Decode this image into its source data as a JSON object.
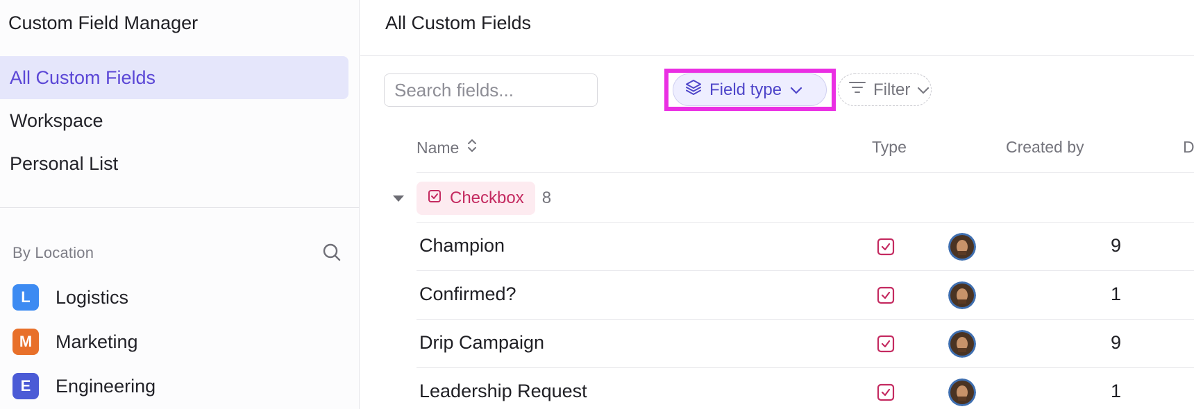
{
  "sidebar": {
    "title": "Custom Field Manager",
    "nav": [
      {
        "label": "All Custom Fields",
        "active": true
      },
      {
        "label": "Workspace",
        "active": false
      },
      {
        "label": "Personal List",
        "active": false
      }
    ],
    "section_label": "By Location",
    "section_search_icon": "search-icon",
    "locations": [
      {
        "badge": "L",
        "label": "Logistics",
        "color": "#3d8bf2"
      },
      {
        "badge": "M",
        "label": "Marketing",
        "color": "#e8702a"
      },
      {
        "badge": "E",
        "label": "Engineering",
        "color": "#4b5bd6"
      }
    ]
  },
  "main": {
    "title": "All Custom Fields",
    "search": {
      "placeholder": "Search fields...",
      "value": ""
    },
    "field_type_button": {
      "label": "Field type",
      "icon": "layers-icon",
      "highlight_color": "#ea2fe3"
    },
    "filter_button": {
      "label": "Filter",
      "icon": "filter-icon"
    },
    "columns": {
      "name": "Name",
      "type": "Type",
      "created_by": "Created by",
      "date_partial": "D"
    },
    "group": {
      "label": "Checkbox",
      "count": "8",
      "color": "#c42a60"
    },
    "rows": [
      {
        "name": "Champion",
        "date_partial": "9"
      },
      {
        "name": "Confirmed?",
        "date_partial": "1"
      },
      {
        "name": "Drip Campaign",
        "date_partial": "9"
      },
      {
        "name": "Leadership Request",
        "date_partial": "1"
      }
    ]
  },
  "colors": {
    "accent": "#5b47d6",
    "active_nav_bg": "#e5e6fb",
    "checkbox_pink": "#c42a60"
  }
}
